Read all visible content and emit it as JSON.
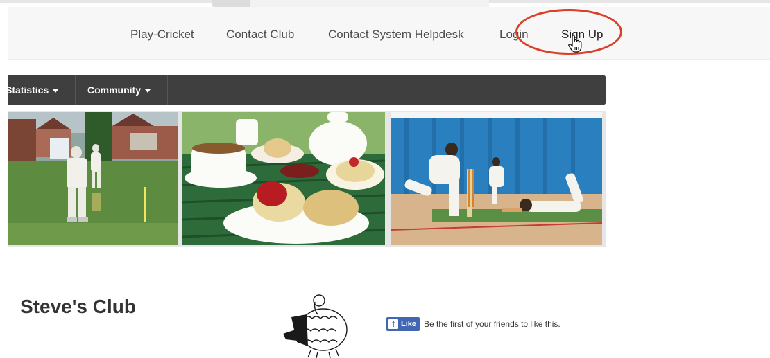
{
  "browser": {
    "top_strip": "browser-tab-strip"
  },
  "topnav": {
    "links": [
      {
        "label": "Play-Cricket"
      },
      {
        "label": "Contact Club"
      },
      {
        "label": "Contact System Helpdesk"
      },
      {
        "label": "Login"
      },
      {
        "label": "Sign Up"
      }
    ],
    "highlight_color": "#d9402a"
  },
  "menu": {
    "items": [
      {
        "label": "Statistics"
      },
      {
        "label": "Community"
      }
    ],
    "background": "#3f3f3f"
  },
  "banner": {
    "photos": [
      {
        "subject": "batsman-at-crease-photo"
      },
      {
        "subject": "cream-tea-scones-photo"
      },
      {
        "subject": "indoor-cricket-diving-keeper-photo"
      }
    ]
  },
  "club": {
    "name": "Steve's Club",
    "logo": "sheep-sketch-logo"
  },
  "facebook": {
    "like_label": "Like",
    "like_text": "Be the first of your friends to like this.",
    "brand_color": "#4267b2"
  },
  "cursor": {
    "icon": "hand-pointer-icon"
  }
}
